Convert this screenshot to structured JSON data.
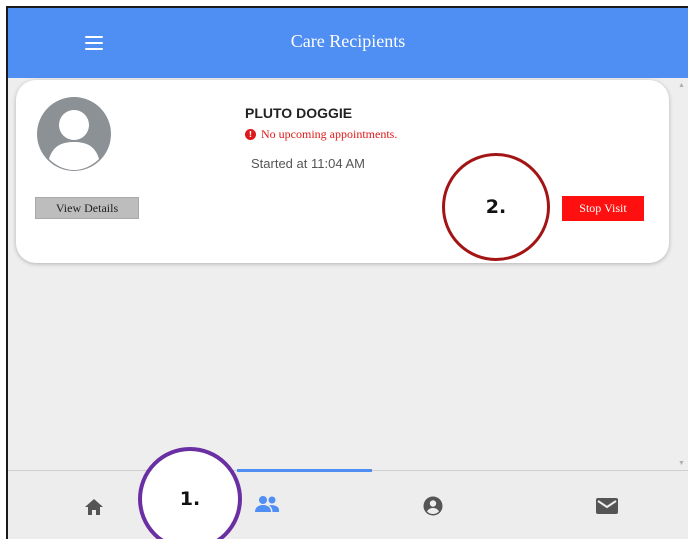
{
  "header": {
    "title": "Care Recipients",
    "menu_icon": "hamburger-menu-icon",
    "color": "#4f8ef2"
  },
  "card": {
    "patient_name": "PLUTO DOGGIE",
    "appointment_status": "No upcoming appointments.",
    "appointment_icon": "info-icon",
    "started_text": "Started at 11:04 AM",
    "view_details_label": "View Details",
    "stop_visit_label": "Stop Visit",
    "stop_visit_color": "#ff1010",
    "avatar_icon": "avatar-placeholder-icon"
  },
  "annotations": {
    "callout_1": "1.",
    "callout_2": "2."
  },
  "bottom_nav": {
    "items": [
      {
        "icon": "home-icon",
        "active": false
      },
      {
        "icon": "people-icon",
        "active": true
      },
      {
        "icon": "account-circle-icon",
        "active": false
      },
      {
        "icon": "mail-icon",
        "active": false
      }
    ],
    "active_color": "#4f8ef2"
  }
}
